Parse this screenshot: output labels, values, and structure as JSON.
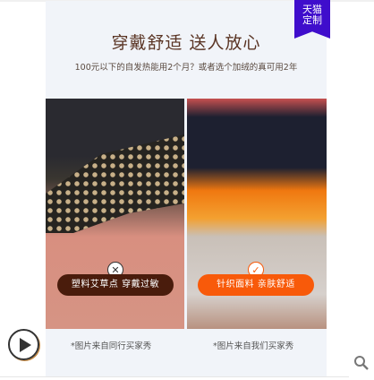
{
  "badge": {
    "line1": "天猫",
    "line2": "定制",
    "color": "#3f0dcc"
  },
  "header": {
    "title": "穿戴舒适 送人放心",
    "subtitle": "100元以下的自发热能用2个月？或者选个加绒的真可用2年"
  },
  "comparison": {
    "left": {
      "mark_icon": "x-icon",
      "label": "塑料艾草点 穿戴过敏",
      "caption": "*图片来自同行买家秀",
      "color": "#4a1c0c"
    },
    "right": {
      "mark_icon": "check-icon",
      "label": "针织面料 亲肤舒适",
      "caption": "*图片来自我们买家秀",
      "color": "#f85a0a"
    }
  },
  "controls": {
    "play_icon": "play-icon",
    "search_icon": "search-icon"
  }
}
